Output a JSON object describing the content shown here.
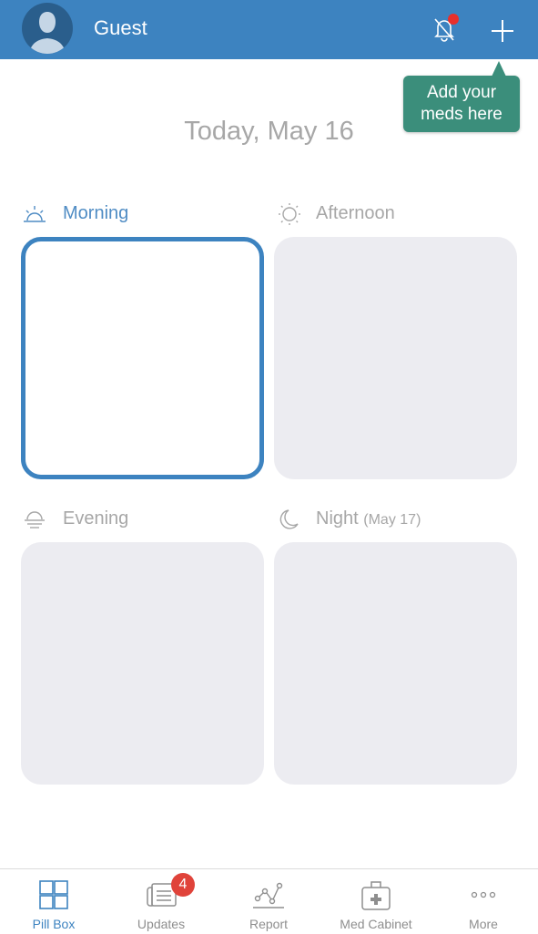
{
  "header": {
    "username": "Guest",
    "avatar_icon": "user-silhouette-icon",
    "notifications_icon": "bell-muted-icon",
    "add_icon": "plus-icon"
  },
  "tooltip": {
    "text_line1": "Add your",
    "text_line2": "meds here"
  },
  "date_title": "Today, May 16",
  "sections": [
    {
      "label": "Morning",
      "icon": "sunrise-icon",
      "active": true
    },
    {
      "label": "Afternoon",
      "icon": "sun-icon",
      "active": false
    },
    {
      "label": "Evening",
      "icon": "sunset-icon",
      "active": false
    },
    {
      "label": "Night",
      "sublabel": "(May 17)",
      "icon": "moon-icon",
      "active": false
    }
  ],
  "tabbar": {
    "tabs": [
      {
        "label": "Pill Box",
        "icon": "grid-icon",
        "active": true
      },
      {
        "label": "Updates",
        "icon": "newspaper-icon",
        "badge": "4"
      },
      {
        "label": "Report",
        "icon": "chart-line-icon"
      },
      {
        "label": "Med Cabinet",
        "icon": "medical-kit-icon"
      },
      {
        "label": "More",
        "icon": "more-dots-icon"
      }
    ]
  },
  "colors": {
    "brand": "#3d83c0",
    "tooltip": "#3b8e7b",
    "badge": "#e0433a",
    "slot_bg": "#ececf1"
  }
}
